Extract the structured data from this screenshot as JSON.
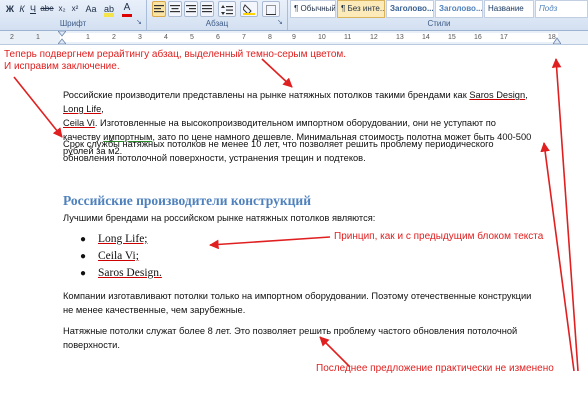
{
  "ribbon": {
    "groups": {
      "font": "Шрифт",
      "paragraph": "Абзац",
      "styles": "Стили"
    },
    "styles": [
      "¶ Обычный",
      "¶ Без инте...",
      "Заголово...",
      "Заголово...",
      "Название",
      "Подз"
    ],
    "font_controls": [
      "Ж",
      "К",
      "Ч",
      "abe",
      "x₂",
      "x²",
      "Aa",
      "A"
    ]
  },
  "ruler": {
    "ticks": [
      "2",
      "1",
      "1",
      "2",
      "3",
      "4",
      "5",
      "6",
      "7",
      "8",
      "9",
      "10",
      "11",
      "12",
      "13",
      "14",
      "15",
      "16",
      "17",
      "18"
    ]
  },
  "notes": {
    "top": "Теперь подвергнем рерайтингу абзац, выделенный темно-серым цветом.",
    "top2": "И исправим заключение.",
    "middle": "Принцип, как и с предыдущим блоком текста",
    "bottom": "Последнее предложение практически не изменено"
  },
  "document": {
    "para1": {
      "a": "Российские производители представлены на рынке натяжных потолков такими брендами как ",
      "brand1": "Saros Design",
      "sep1": ", ",
      "brand2": "Long Life",
      "sep2": ",",
      "brand3": "Ceila Vi",
      "b": ". Изготовленные на высокопроизводительном импортном оборудовании, они не уступают по качеству ",
      "word": "импортным",
      "c": ", зато по цене намного дешевле. Минимальная стоимость полотна может быть 400-500  рублей за м2."
    },
    "para2": "Срок службы натяжных потолков не менее 10 лет, что позволяет решить проблему периодического обновления потолочной поверхности, устранения трещин и подтеков.",
    "heading": "Российские производители конструкций",
    "intro": "Лучшими брендами на российском рынке натяжных потолков  являются:",
    "list": [
      "Long Life;",
      "Ceila Vi;",
      "Saros Design."
    ],
    "para3": "Компании изготавливают потолки только на импортном оборудовании. Поэтому отечественные конструкции не менее качественные, чем зарубежные.",
    "para4": "Натяжные потолки служат более 8 лет. Это позволяет решить проблему частого обновления потолочной поверхности."
  },
  "colors": {
    "annotation": "#e02020",
    "heading": "#4f81bd"
  }
}
